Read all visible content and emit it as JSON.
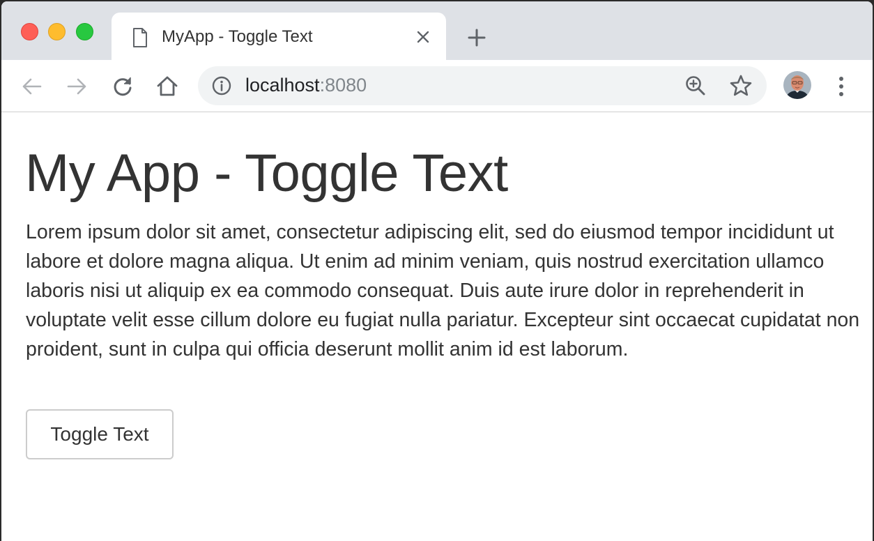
{
  "browser": {
    "tab": {
      "title": "MyApp - Toggle Text"
    },
    "address_bar": {
      "host": "localhost",
      "port": ":8080"
    }
  },
  "page": {
    "heading": "My App - Toggle Text",
    "paragraph": "Lorem ipsum dolor sit amet, consectetur adipiscing elit, sed do eiusmod tempor incididunt ut labore et dolore magna aliqua. Ut enim ad minim veniam, quis nostrud exercitation ullamco laboris nisi ut aliquip ex ea commodo consequat. Duis aute irure dolor in reprehenderit in voluptate velit esse cillum dolore eu fugiat nulla pariatur. Excepteur sint occaecat cupidatat non proident, sunt in culpa qui officia deserunt mollit anim id est laborum.",
    "toggle_button_label": "Toggle Text"
  },
  "icons": {
    "tab_page": "page-icon",
    "tab_close": "close-icon",
    "new_tab": "plus-icon",
    "back": "arrow-left-icon",
    "forward": "arrow-right-icon",
    "reload": "reload-icon",
    "home": "home-icon",
    "site_info": "info-icon",
    "zoom": "zoom-in-icon",
    "bookmark": "star-icon",
    "menu": "kebab-menu-icon"
  },
  "colors": {
    "traffic_red": "#fe5f57",
    "traffic_yellow": "#febc2e",
    "traffic_green": "#28c840",
    "tabstrip_bg": "#dee1e6",
    "omnibox_bg": "#f1f3f4",
    "text": "#333333"
  }
}
